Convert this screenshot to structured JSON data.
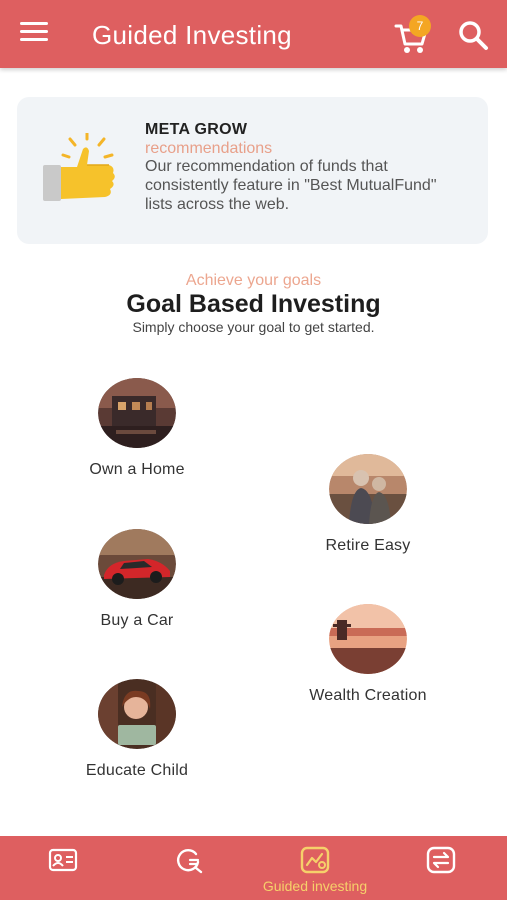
{
  "header": {
    "title": "Guided Investing",
    "cart_count": "7",
    "menu_icon": "hamburger-menu-icon",
    "cart_icon": "cart-icon",
    "search_icon": "search-icon"
  },
  "recommendation": {
    "title": "META GROW",
    "subtitle": "recommendations",
    "description": "Our recommendation of funds that consistently feature in \"Best MutualFund\" lists across the web.",
    "icon": "thumbs-up-icon"
  },
  "goals_section": {
    "kicker": "Achieve your goals",
    "title": "Goal Based Investing",
    "subtitle": "Simply choose your goal to get started."
  },
  "goals": [
    {
      "label": "Own a Home"
    },
    {
      "label": "Retire Easy"
    },
    {
      "label": "Buy a Car"
    },
    {
      "label": "Wealth Creation"
    },
    {
      "label": "Educate Child"
    }
  ],
  "bottom_nav": {
    "items": [
      {
        "icon": "contact-card-icon",
        "label": ""
      },
      {
        "icon": "search-refresh-icon",
        "label": ""
      },
      {
        "icon": "guided-investing-icon",
        "label": "Guided investing",
        "active": true
      },
      {
        "icon": "exchange-icon",
        "label": ""
      }
    ]
  },
  "colors": {
    "primary": "#de5f60",
    "accent": "#f4a623",
    "active_nav": "#f6d06a",
    "kicker": "#eca68f",
    "card_bg": "#f1f4f7"
  }
}
